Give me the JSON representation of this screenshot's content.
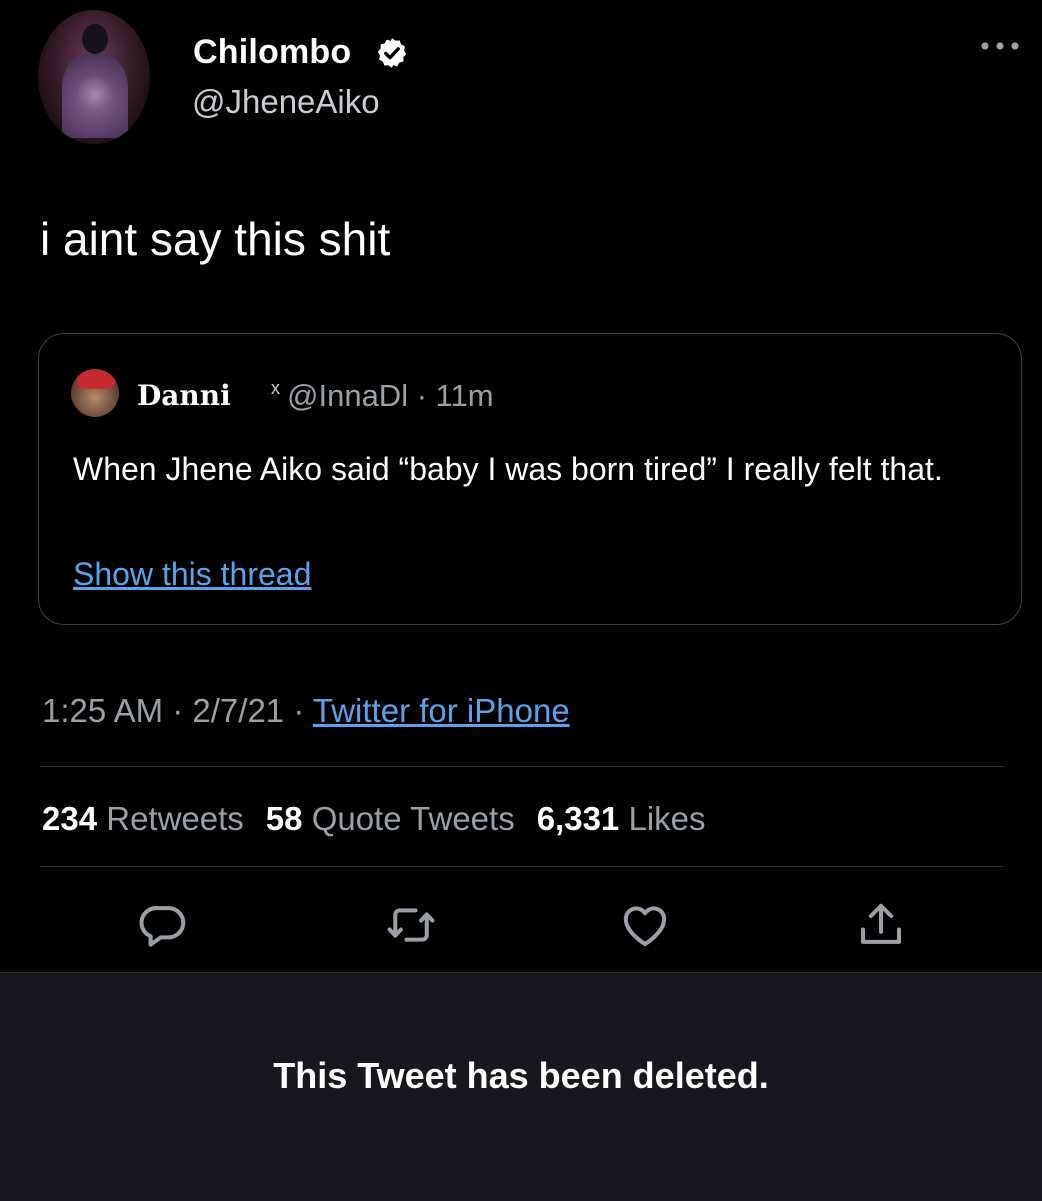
{
  "author": {
    "display_name": "Chilombo",
    "handle": "@JheneAiko",
    "verified": true
  },
  "tweet": {
    "text": "i aint say this shit"
  },
  "quoted_tweet": {
    "name": "Danni",
    "name_mark": "x",
    "meta": "@InnaDl · 11m",
    "text": "When Jhene Aiko said “baby I was born tired” I really felt that.",
    "link": "Show this thread"
  },
  "timestamp": {
    "time_date": "1:25 AM · 2/7/21 · ",
    "source": "Twitter for iPhone"
  },
  "stats": {
    "retweets_count": "234",
    "retweets_label": "Retweets",
    "quotes_count": "58",
    "quotes_label": "Quote Tweets",
    "likes_count": "6,331",
    "likes_label": "Likes"
  },
  "actions": [
    "reply-icon",
    "retweet-icon",
    "like-icon",
    "share-icon"
  ],
  "deleted_notice": "This Tweet has been deleted.",
  "colors": {
    "background": "#000000",
    "link": "#5aa3ea",
    "verified": "#ffffff",
    "muted": "#9aa0a6",
    "deleted_bg": "#16181c"
  }
}
